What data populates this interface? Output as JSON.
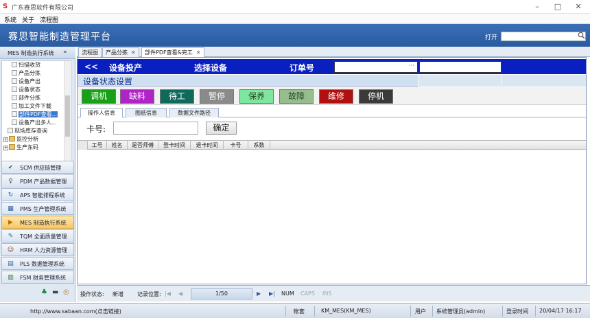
{
  "window": {
    "title": "广东赛思软件有限公司",
    "min": "–",
    "max": "□",
    "close": "✕"
  },
  "menu": [
    "系统",
    "关于",
    "流程图"
  ],
  "app": {
    "title": "赛思智能制造管理平台",
    "open_label": "打开",
    "open_value": ""
  },
  "left": {
    "header": "MES 制造执行系统",
    "collapse": "«",
    "tree": [
      {
        "label": "扫描收货",
        "type": "leaf"
      },
      {
        "label": "产品分拣",
        "type": "leaf"
      },
      {
        "label": "设备产出",
        "type": "leaf"
      },
      {
        "label": "设备状态",
        "type": "leaf"
      },
      {
        "label": "部件分拣",
        "type": "leaf"
      },
      {
        "label": "加工文件下载",
        "type": "leaf"
      },
      {
        "label": "部件PDF查看...",
        "type": "leaf",
        "selected": true
      },
      {
        "label": "设备产出多人...",
        "type": "leaf"
      },
      {
        "label": "现场库存查询",
        "type": "leaf"
      },
      {
        "label": "监控分析",
        "type": "folder"
      },
      {
        "label": "生产东码",
        "type": "folder"
      }
    ],
    "modules": [
      {
        "label": "SCM 供应链管理",
        "icon": "✔"
      },
      {
        "label": "PDM 产品数据管理",
        "icon": "♀"
      },
      {
        "label": "APS 智能排程系统",
        "icon": "↻"
      },
      {
        "label": "PMS 生产管理系统",
        "icon": "▦"
      },
      {
        "label": "MES 制造执行系统",
        "icon": "▶",
        "active": true
      },
      {
        "label": "TQM 全面质量管理",
        "icon": "✎"
      },
      {
        "label": "HRM 人力资源管理",
        "icon": "☺"
      },
      {
        "label": "PLS 数据管理系统",
        "icon": "▤"
      },
      {
        "label": "FSM 财务管理系统",
        "icon": "▥"
      }
    ]
  },
  "tabs": [
    {
      "label": "流程图",
      "closable": false
    },
    {
      "label": "产品分拣",
      "closable": true
    },
    {
      "label": "部件PDF查看&完工",
      "closable": true,
      "active": true
    }
  ],
  "header_bar": {
    "back": "<<",
    "device_in": "设备投产",
    "select_device": "选择设备",
    "order_no": "订单号",
    "order_ellipsis": "···",
    "order_value": ""
  },
  "status_section": {
    "title": "设备状态设置"
  },
  "status_buttons": [
    {
      "label": "调机",
      "color": "#18a018"
    },
    {
      "label": "缺料",
      "color": "#b023c7"
    },
    {
      "label": "待工",
      "color": "#106a5c"
    },
    {
      "label": "暂停",
      "color": "#8a8a8a"
    },
    {
      "label": "保养",
      "color": "#7fe6a0"
    },
    {
      "label": "故障",
      "color": "#97bd8e"
    },
    {
      "label": "维修",
      "color": "#b01010"
    },
    {
      "label": "停机",
      "color": "#3a3a3a"
    }
  ],
  "sub_tabs": [
    "操作人信息",
    "图纸信息",
    "数据文件路径"
  ],
  "card": {
    "label": "卡号:",
    "value": "",
    "confirm": "确定"
  },
  "grid": {
    "columns": [
      "工号",
      "姓名",
      "是否师傅",
      "登卡时间",
      "退卡时间",
      "卡号",
      "系数"
    ],
    "rows": []
  },
  "bottom": {
    "op_state_label": "操作状态:",
    "op_state_value": "新增",
    "record_label": "记录位置:",
    "first": "|◀",
    "prev": "◀",
    "page": "1/50",
    "next": "▶",
    "last": "▶|",
    "num": "NUM",
    "caps": "CAPS",
    "ins": "INS"
  },
  "footer": {
    "url": "http://www.sabaan.com(点击链接)",
    "account_label": "帐套",
    "account_value": "KM_MES(KM_MES)",
    "user_label": "用户",
    "user_value": "系统管理员(admin)",
    "login_label": "登录时间",
    "login_value": "20/04/17 16:17"
  }
}
